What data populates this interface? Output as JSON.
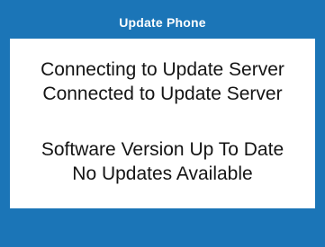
{
  "dialog": {
    "title": "Update Phone",
    "messages": [
      "Connecting to Update Server",
      "Connected to Update Server",
      "Software Version Up To Date",
      "No Updates Available"
    ]
  },
  "colors": {
    "frame": "#1b75b7",
    "panel": "#ffffff",
    "text": "#141414",
    "title_text": "#ffffff"
  }
}
